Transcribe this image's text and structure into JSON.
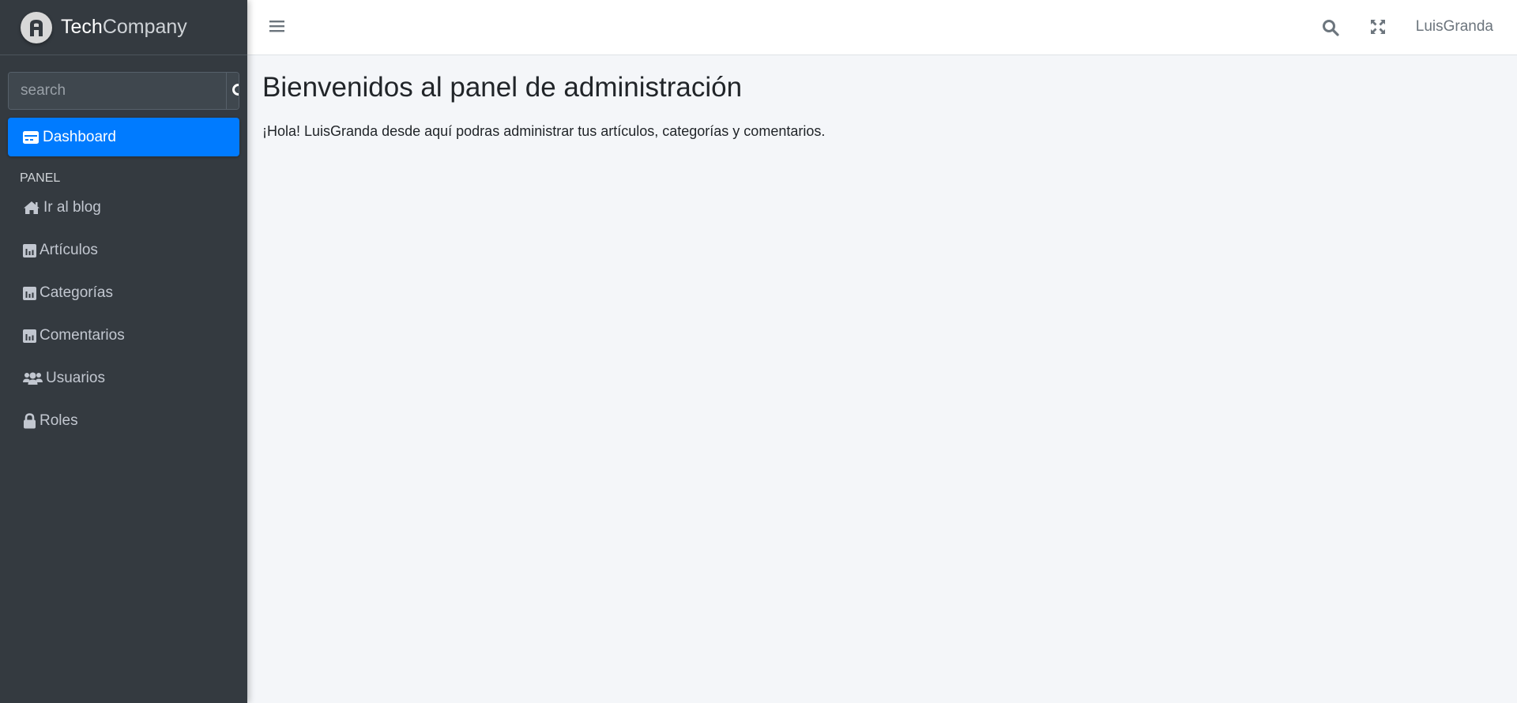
{
  "brand": {
    "name_bold": "Tech",
    "name_light": "Company"
  },
  "sidebar": {
    "search": {
      "placeholder": "search"
    },
    "active_item": {
      "label": "Dashboard",
      "icon": "dashboard-icon"
    },
    "section_header": "PANEL",
    "items": [
      {
        "label": "Ir al blog",
        "icon": "home-icon"
      },
      {
        "label": "Artículos",
        "icon": "chart-icon"
      },
      {
        "label": "Categorías",
        "icon": "chart-icon"
      },
      {
        "label": "Comentarios",
        "icon": "chart-icon"
      },
      {
        "label": "Usuarios",
        "icon": "users-icon"
      },
      {
        "label": "Roles",
        "icon": "lock-icon"
      }
    ]
  },
  "topbar": {
    "username": "LuisGranda"
  },
  "main": {
    "title": "Bienvenidos al panel de administración",
    "welcome_text": "¡Hola! LuisGranda desde aquí podras administrar tus artículos, categorías y comentarios."
  },
  "colors": {
    "sidebar_bg": "#343a40",
    "active_item_bg": "#007bff",
    "content_bg": "#f4f6f9",
    "topbar_bg": "#ffffff"
  }
}
